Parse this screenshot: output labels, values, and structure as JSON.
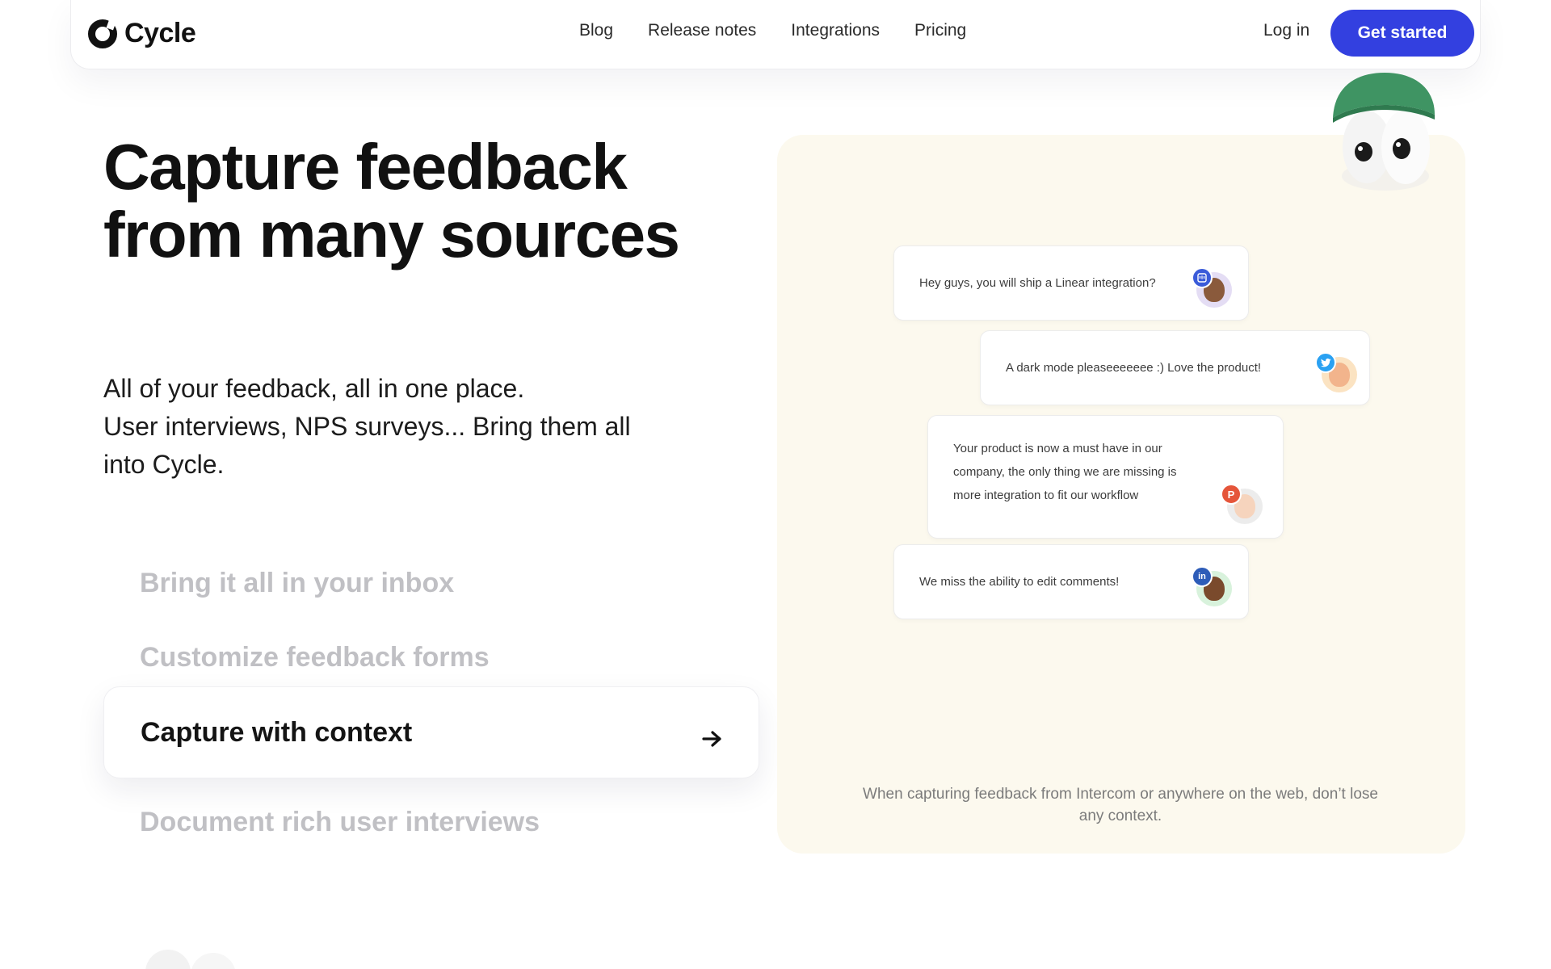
{
  "brand": {
    "name": "Cycle"
  },
  "nav": {
    "links": [
      "Blog",
      "Release notes",
      "Integrations",
      "Pricing"
    ],
    "login": "Log in",
    "cta": "Get started"
  },
  "hero": {
    "headline": "Capture feedback from many sources",
    "subtext_lines": [
      "All of your feedback, all in one place.",
      "User interviews, NPS surveys... Bring them all",
      "into Cycle."
    ]
  },
  "features": [
    {
      "label": "Bring it all in your inbox",
      "active": false
    },
    {
      "label": "Customize feedback forms",
      "active": false
    },
    {
      "label": "Capture with context",
      "active": true
    },
    {
      "label": "Document rich user interviews",
      "active": false
    }
  ],
  "panel": {
    "cards": [
      {
        "lines": [
          "Hey guys, you will ship a Linear integration?"
        ],
        "source": "intercom",
        "badge": "",
        "badge_color": "#3a5bd9",
        "avatar_bg": "#e4ddf4",
        "face": "#8a5a3c"
      },
      {
        "lines": [
          "A dark mode pleaseeeeeee :) Love the product!"
        ],
        "source": "twitter",
        "badge": "",
        "badge_color": "#2aa1f2",
        "avatar_bg": "#fbe3c2",
        "face": "#f2b48c"
      },
      {
        "lines": [
          "Your product is now a must have in our",
          "company, the only thing we are missing is",
          "more integration to fit our workflow"
        ],
        "source": "producthunt",
        "badge": "P",
        "badge_color": "#e5553a",
        "avatar_bg": "#ececec",
        "face": "#f6d4bd"
      },
      {
        "lines": [
          "We miss the ability to edit comments!"
        ],
        "source": "linkedin",
        "badge": "in",
        "badge_color": "#2d5cb8",
        "avatar_bg": "#d8f2dc",
        "face": "#7a4a2c"
      }
    ],
    "caption": "When capturing feedback from Intercom or anywhere on the web, don’t lose any context.",
    "colors": {
      "panel_bg": "#fcf9ee",
      "mascot_hat": "#3f9463"
    }
  },
  "colors": {
    "accent": "#3340e0",
    "inactive_text": "#c0c0c4"
  }
}
